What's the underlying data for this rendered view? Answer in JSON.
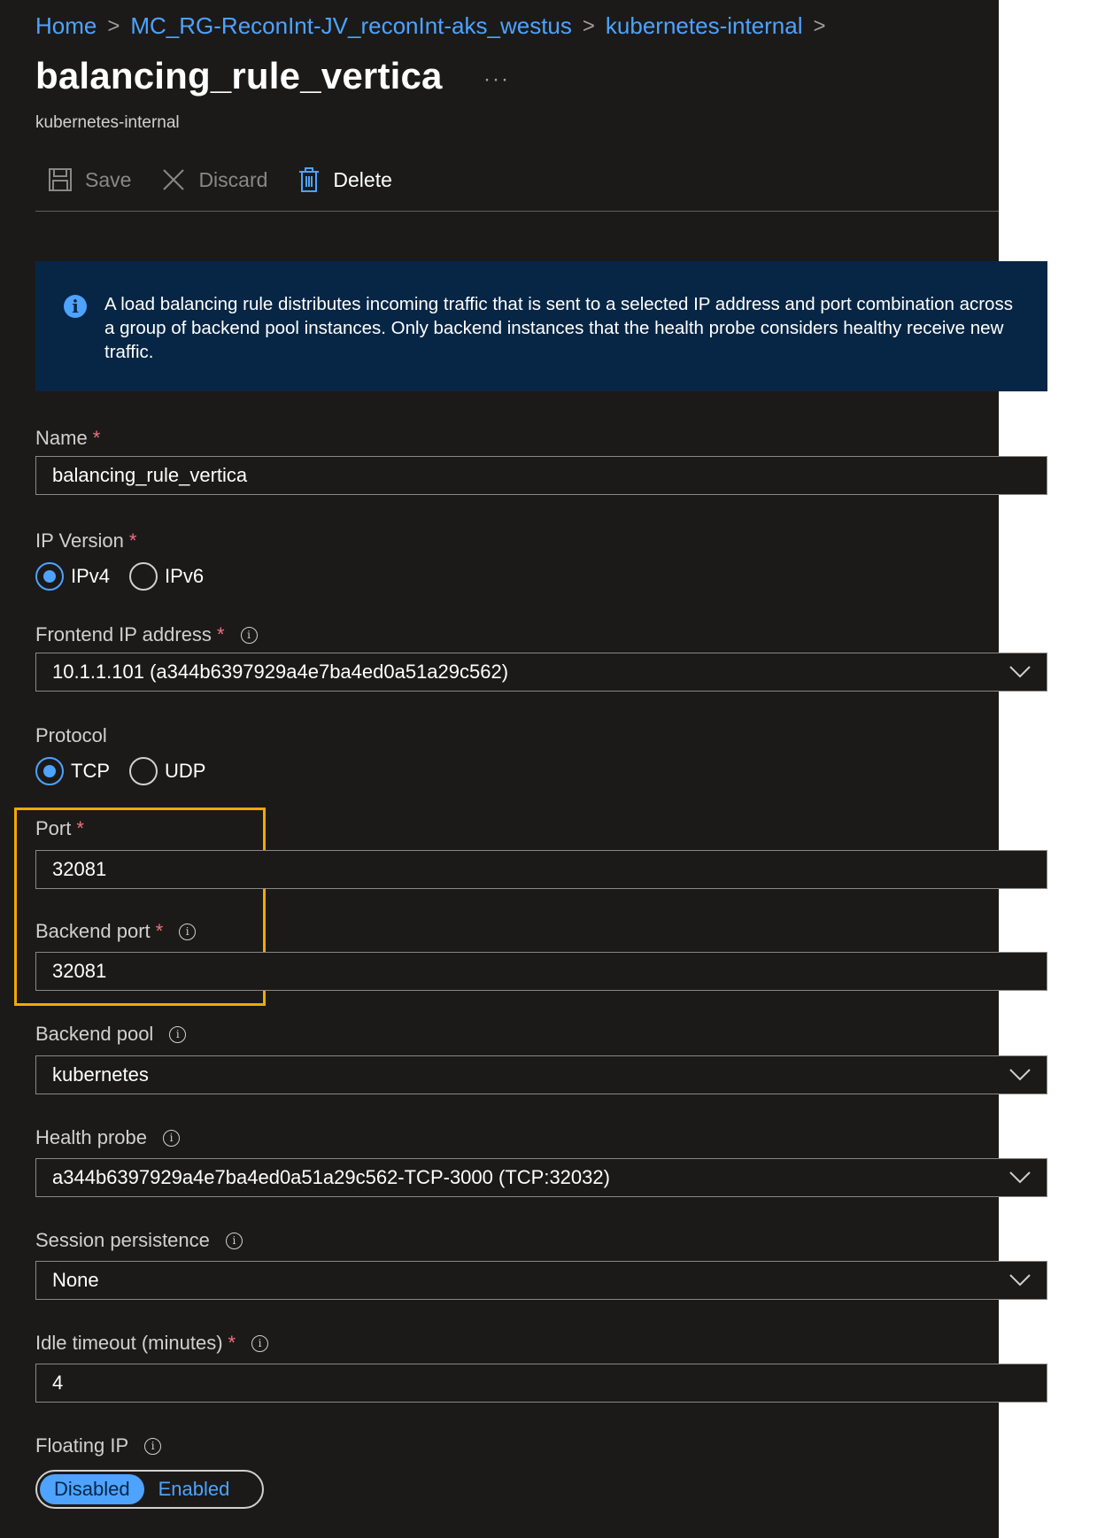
{
  "breadcrumb": [
    "Home",
    "MC_RG-ReconInt-JV_reconInt-aks_westus",
    "kubernetes-internal"
  ],
  "page": {
    "title": "balancing_rule_vertica",
    "more": "···",
    "subtitle": "kubernetes-internal"
  },
  "toolbar": {
    "save": "Save",
    "discard": "Discard",
    "delete": "Delete"
  },
  "info": "A load balancing rule distributes incoming traffic that is sent to a selected IP address and port combination across a group of backend pool instances. Only backend instances that the health probe considers healthy receive new traffic.",
  "form": {
    "name": {
      "label": "Name",
      "value": "balancing_rule_vertica"
    },
    "ip_version": {
      "label": "IP Version",
      "options": [
        "IPv4",
        "IPv6"
      ],
      "selected": "IPv4"
    },
    "frontend_ip": {
      "label": "Frontend IP address",
      "value": "10.1.1.101 (a344b6397929a4e7ba4ed0a51a29c562)"
    },
    "protocol": {
      "label": "Protocol",
      "options": [
        "TCP",
        "UDP"
      ],
      "selected": "TCP"
    },
    "port": {
      "label": "Port",
      "value": "32081"
    },
    "backend_port": {
      "label": "Backend port",
      "value": "32081"
    },
    "backend_pool": {
      "label": "Backend pool",
      "value": "kubernetes"
    },
    "health_probe": {
      "label": "Health probe",
      "value": "a344b6397929a4e7ba4ed0a51a29c562-TCP-3000 (TCP:32032)"
    },
    "session_persistence": {
      "label": "Session persistence",
      "value": "None"
    },
    "idle_timeout": {
      "label": "Idle timeout (minutes)",
      "value": "4"
    },
    "floating_ip": {
      "label": "Floating IP",
      "options": [
        "Disabled",
        "Enabled"
      ],
      "selected": "Disabled"
    }
  },
  "required_mark": "*",
  "info_glyph": "i",
  "colors": {
    "accent": "#4da3ff",
    "required": "#f1707b",
    "highlight": "#f2a900",
    "info_bg": "#072645",
    "page_bg": "#1b1a19"
  }
}
